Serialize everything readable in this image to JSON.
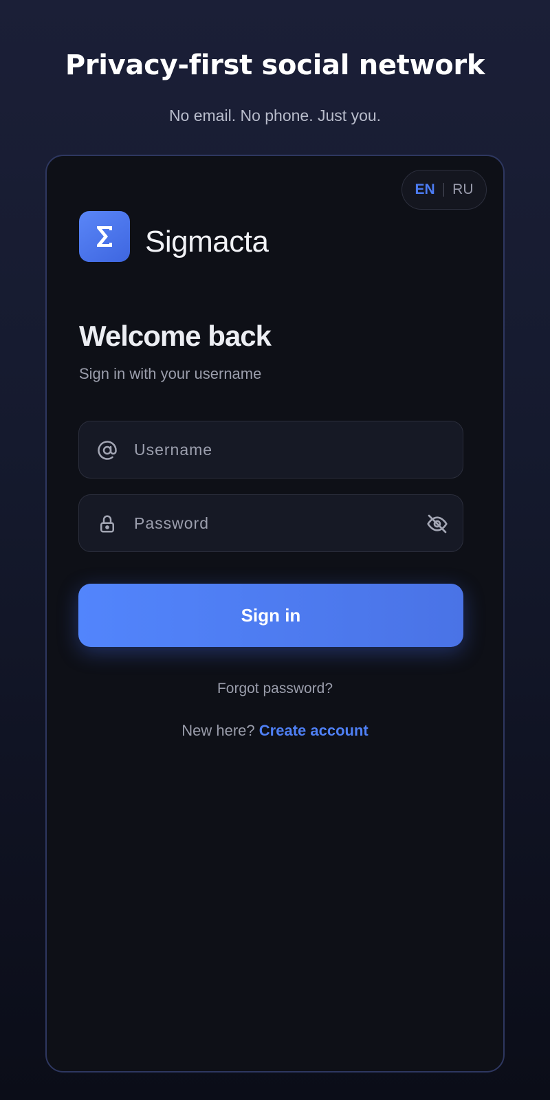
{
  "hero": {
    "title": "Privacy-first social network",
    "subtitle": "No email. No phone. Just you."
  },
  "language_switch": {
    "options": [
      "EN",
      "RU"
    ],
    "selected": "EN"
  },
  "brand": {
    "logo_icon": "sigma-logo-icon",
    "logo_glyph": "Σ",
    "name": "Sigmacta"
  },
  "login": {
    "heading": "Welcome back",
    "subheading": "Sign in with your username",
    "username_field": {
      "icon": "at-sign-icon",
      "placeholder": "Username",
      "value": ""
    },
    "password_field": {
      "icon": "lock-icon",
      "placeholder": "Password",
      "value": "",
      "toggle_icon": "eye-off-icon"
    },
    "submit_label": "Sign in",
    "forgot_label": "Forgot password?",
    "register_prompt": "New here?",
    "register_link": "Create account"
  },
  "colors": {
    "accent": "#4f80f5",
    "card_border": "#2e3760",
    "card_bg": "#0e1017"
  }
}
